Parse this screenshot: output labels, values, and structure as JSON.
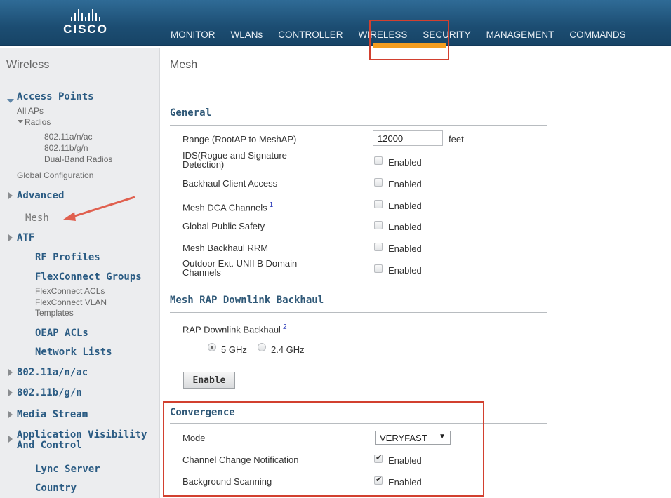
{
  "brand": {
    "name": "CISCO"
  },
  "nav": {
    "items": [
      {
        "pre": "",
        "u": "M",
        "post": "ONITOR"
      },
      {
        "pre": "",
        "u": "W",
        "post": "LANs"
      },
      {
        "pre": "",
        "u": "C",
        "post": "ONTROLLER"
      },
      {
        "pre": "W",
        "u": "I",
        "post": "RELESS"
      },
      {
        "pre": "",
        "u": "S",
        "post": "ECURITY"
      },
      {
        "pre": "M",
        "u": "A",
        "post": "NAGEMENT"
      },
      {
        "pre": "C",
        "u": "O",
        "post": "MMANDS"
      }
    ],
    "active": "WIRELESS",
    "accent_color": "#f39d1f",
    "highlight_color": "#d2402f"
  },
  "sidebar": {
    "title": "Wireless",
    "access_points": "Access Points",
    "all_aps": "All APs",
    "radios": "Radios",
    "radio_a": "802.11a/n/ac",
    "radio_b": "802.11b/g/n",
    "radio_dual": "Dual-Band Radios",
    "global_config": "Global Configuration",
    "advanced": "Advanced",
    "mesh": "Mesh",
    "atf": "ATF",
    "rf_profiles": "RF Profiles",
    "flex_groups": "FlexConnect Groups",
    "flex_acls": "FlexConnect ACLs",
    "flex_vlan_1": "FlexConnect VLAN",
    "flex_vlan_2": "Templates",
    "oeap": "OEAP ACLs",
    "network_lists": "Network Lists",
    "a_n_ac": "802.11a/n/ac",
    "b_g_n": "802.11b/g/n",
    "media_stream": "Media Stream",
    "avc_1": "Application Visibility",
    "avc_2": "And Control",
    "lync": "Lync Server",
    "country": "Country"
  },
  "main": {
    "title": "Mesh",
    "general": {
      "heading": "General",
      "range_label": "Range (RootAP to MeshAP)",
      "range_value": "12000",
      "range_unit": "feet",
      "ids_label_1": "IDS(Rogue and Signature",
      "ids_label_2": "Detection)",
      "backhaul_client": "Backhaul Client Access",
      "dca_label": "Mesh DCA Channels",
      "dca_help": "1",
      "public_safety": "Global Public Safety",
      "backhaul_rrm": "Mesh Backhaul RRM",
      "outdoor_1": "Outdoor Ext. UNII B Domain",
      "outdoor_2": "Channels",
      "enabled": "Enabled"
    },
    "rap": {
      "heading": "Mesh RAP Downlink Backhaul",
      "label": "RAP Downlink Backhaul",
      "help": "2",
      "opt_5": "5 GHz",
      "opt_24": "2.4 GHz",
      "selected": "5 GHz",
      "button": "Enable"
    },
    "convergence": {
      "heading": "Convergence",
      "mode_label": "Mode",
      "mode_value": "VERYFAST",
      "channel_change": "Channel Change Notification",
      "bg_scanning": "Background Scanning",
      "enabled": "Enabled"
    }
  }
}
